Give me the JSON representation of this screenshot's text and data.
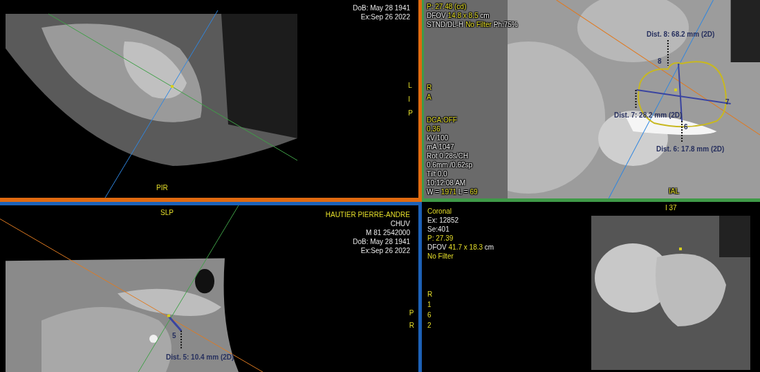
{
  "rows": [
    {
      "viewports": [
        {
          "color": "#e06a10",
          "info": [
            [
              {
                "text": "DoB: May 28 1941",
                "highlight": false
              }
            ],
            [
              {
                "text": "Ex:Sep 26 2022",
                "highlight": false
              }
            ]
          ],
          "side_labels": [
            "L",
            "I",
            "P"
          ],
          "edge_label": "PIR"
        },
        {
          "color": "#3f9a48",
          "info": [
            [
              {
                "text": "P: 27.48 (cd)",
                "highlight": true
              }
            ],
            [
              {
                "text": "DFOV ",
                "highlight": false
              },
              {
                "text": "14.8 x 8.5",
                "highlight": true
              },
              {
                "text": " cm",
                "highlight": false
              }
            ],
            [
              {
                "text": "STND/DL-H ",
                "highlight": false
              },
              {
                "text": "No Filter",
                "highlight": true
              },
              {
                "text": " Ph:75%",
                "highlight": false
              }
            ]
          ],
          "info_2": [
            [
              {
                "text": "DCA:OFF",
                "highlight": true
              }
            ],
            [
              {
                "text": "0.36",
                "highlight": true
              }
            ],
            [
              {
                "text": "kV 100",
                "highlight": false
              }
            ],
            [
              {
                "text": "mA 1047",
                "highlight": false
              }
            ],
            [
              {
                "text": "Rot 0.28s/CH",
                "highlight": false
              }
            ],
            [
              {
                "text": "0.6mm /0.62sp",
                "highlight": false
              }
            ],
            [
              {
                "text": "Tilt 0.0",
                "highlight": false
              }
            ],
            [
              {
                "text": "10:12:08 AM",
                "highlight": false
              }
            ],
            [
              {
                "text": "W = ",
                "highlight": false
              },
              {
                "text": "1971",
                "highlight": true
              },
              {
                "text": " L = ",
                "highlight": false
              },
              {
                "text": "69",
                "highlight": true
              }
            ]
          ],
          "side_labels": [
            "R",
            "A"
          ],
          "edge_label": "IAL",
          "measurements": [
            {
              "number": "8",
              "label": "Dist. 8: 68.2 mm (2D)"
            },
            {
              "number": "7",
              "label": "Dist. 7: 28.2 mm (2D)"
            },
            {
              "number": "6",
              "label": "Dist. 6: 17.8 mm (2D)"
            }
          ]
        }
      ]
    },
    {
      "viewports": [
        {
          "color": "#1d62b8",
          "info": [
            [
              {
                "text": "HAUTIER PIERRE-ANDRE",
                "highlight": true
              }
            ],
            [
              {
                "text": "CHUV",
                "highlight": false
              }
            ],
            [
              {
                "text": "M 81 2542000",
                "highlight": false
              }
            ],
            [
              {
                "text": "DoB: May 28 1941",
                "highlight": false
              }
            ],
            [
              {
                "text": "Ex:Sep 26 2022",
                "highlight": false
              }
            ]
          ],
          "side_labels": [
            "P",
            "R"
          ],
          "edge_label": "SLP",
          "measurements": [
            {
              "number": "5",
              "label": "Dist. 5: 10.4 mm (2D)"
            }
          ]
        },
        {
          "info": [
            [
              {
                "text": "Coronal",
                "highlight": true
              }
            ],
            [
              {
                "text": "Ex: 12852",
                "highlight": false
              }
            ],
            [
              {
                "text": "Se:401",
                "highlight": false
              }
            ],
            [
              {
                "text": "P: 27.39",
                "highlight": true
              }
            ],
            [
              {
                "text": "DFOV ",
                "highlight": false
              },
              {
                "text": "41.7 x 18.3",
                "highlight": true
              },
              {
                "text": " cm",
                "highlight": false
              }
            ],
            [
              {
                "text": "No Filter",
                "highlight": true
              }
            ]
          ],
          "side_labels": [
            "R",
            "1",
            "6",
            "2"
          ],
          "edge_label": "I 37"
        }
      ]
    }
  ]
}
